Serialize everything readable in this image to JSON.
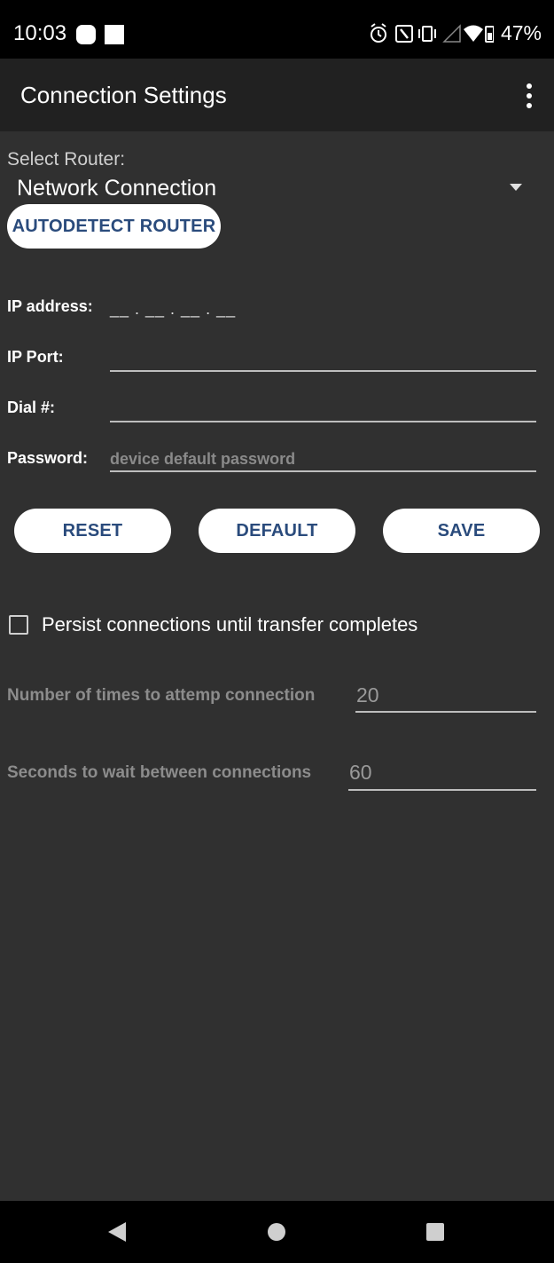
{
  "status_bar": {
    "time": "10:03",
    "battery": "47%",
    "icons": [
      "app-notification-icon",
      "stop-square-icon",
      "alarm-icon",
      "nfc-icon",
      "vibrate-icon",
      "signal-icon",
      "wifi-icon",
      "battery-icon"
    ]
  },
  "app_bar": {
    "title": "Connection Settings",
    "menu_icon": "overflow-menu-icon"
  },
  "router": {
    "label": "Select Router:",
    "selected": "Network Connection",
    "autodetect_label": "AUTODETECT ROUTER"
  },
  "fields": {
    "ip_address_label": "IP address:",
    "ip_address_mask": "__ . __ . __ . __",
    "ip_port_label": "IP Port:",
    "ip_port_value": "",
    "dial_label": "Dial #:",
    "dial_value": "",
    "password_label": "Password:",
    "password_placeholder": "device default password"
  },
  "actions": {
    "reset_label": "RESET",
    "default_label": "DEFAULT",
    "save_label": "SAVE"
  },
  "options": {
    "persist_label": "Persist connections until transfer completes",
    "persist_checked": false,
    "attempts_label": "Number of times to attemp connection",
    "attempts_value": "20",
    "wait_label": "Seconds to wait between connections",
    "wait_value": "60"
  },
  "colors": {
    "background": "#303030",
    "app_bar": "#212121",
    "button_text": "#2a4b7c",
    "button_bg": "#ffffff"
  }
}
